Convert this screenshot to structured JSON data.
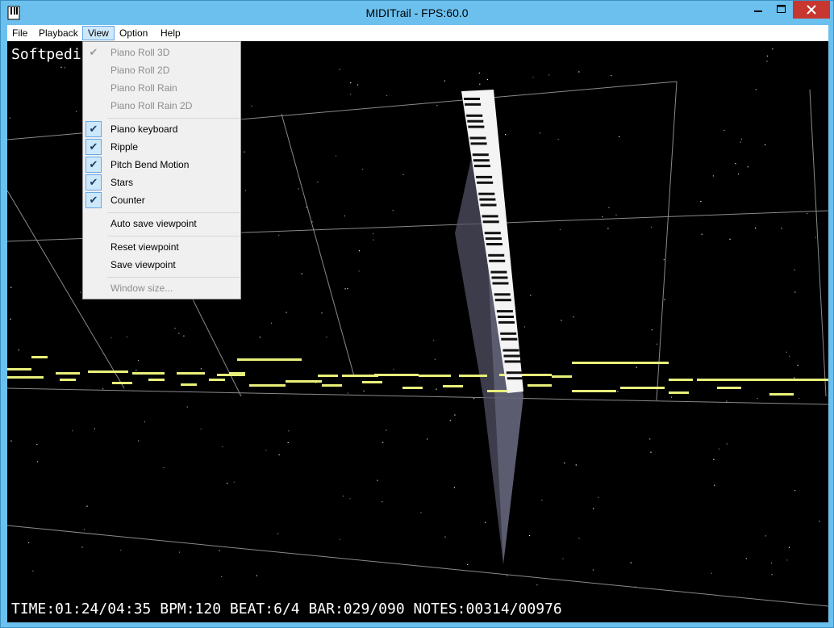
{
  "window": {
    "title": "MIDITrail - FPS:60.0",
    "icon": "midi-document-icon",
    "colors": {
      "frame": "#6cc0ee",
      "close": "#c7372f",
      "menu_highlight": "#cde8fb"
    }
  },
  "menubar": {
    "items": [
      {
        "label": "File"
      },
      {
        "label": "Playback"
      },
      {
        "label": "View"
      },
      {
        "label": "Option"
      },
      {
        "label": "Help"
      }
    ]
  },
  "view_menu": {
    "groups": [
      [
        {
          "label": "Piano Roll 3D",
          "checked": true,
          "enabled": false
        },
        {
          "label": "Piano Roll 2D",
          "checked": false,
          "enabled": false
        },
        {
          "label": "Piano Roll Rain",
          "checked": false,
          "enabled": false
        },
        {
          "label": "Piano Roll Rain 2D",
          "checked": false,
          "enabled": false
        }
      ],
      [
        {
          "label": "Piano keyboard",
          "checked": true,
          "enabled": true
        },
        {
          "label": "Ripple",
          "checked": true,
          "enabled": true
        },
        {
          "label": "Pitch Bend Motion",
          "checked": true,
          "enabled": true
        },
        {
          "label": "Stars",
          "checked": true,
          "enabled": true
        },
        {
          "label": "Counter",
          "checked": true,
          "enabled": true
        }
      ],
      [
        {
          "label": "Auto save viewpoint",
          "checked": false,
          "enabled": true
        }
      ],
      [
        {
          "label": "Reset viewpoint",
          "checked": false,
          "enabled": true
        },
        {
          "label": "Save viewpoint",
          "checked": false,
          "enabled": true
        }
      ],
      [
        {
          "label": "Window size...",
          "checked": false,
          "enabled": false
        }
      ]
    ]
  },
  "viewport": {
    "overlay_label": "Softpedia",
    "status": "TIME:01:24/04:35 BPM:120 BEAT:6/4 BAR:029/090 NOTES:00314/00976",
    "note_color": "#e8f07a"
  }
}
